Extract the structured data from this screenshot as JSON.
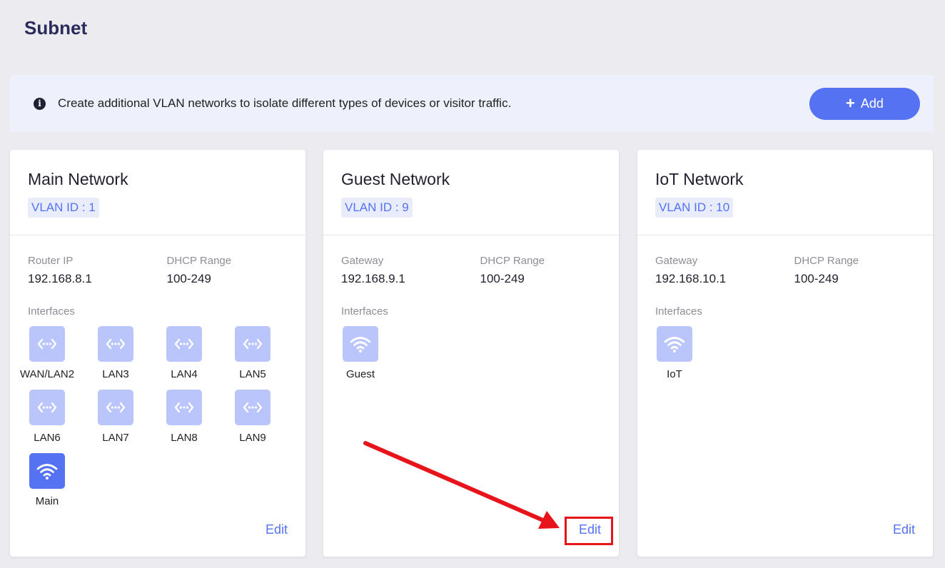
{
  "page": {
    "title": "Subnet"
  },
  "banner": {
    "text": "Create additional VLAN networks to isolate different types of devices or visitor traffic.",
    "add_label": "Add",
    "info_icon": "info-circle-icon"
  },
  "colors": {
    "accent": "#5472f2",
    "tile_inactive": "#b9c5fb",
    "annotation": "#e8141b"
  },
  "cards": [
    {
      "title": "Main Network",
      "vlan": "VLAN ID : 1",
      "fields": [
        {
          "label": "Router IP",
          "value": "192.168.8.1"
        },
        {
          "label": "DHCP Range",
          "value": "100-249"
        }
      ],
      "interfaces_label": "Interfaces",
      "interfaces": [
        {
          "label": "WAN/LAN2",
          "icon": "ethernet-icon",
          "active": false
        },
        {
          "label": "LAN3",
          "icon": "ethernet-icon",
          "active": false
        },
        {
          "label": "LAN4",
          "icon": "ethernet-icon",
          "active": false
        },
        {
          "label": "LAN5",
          "icon": "ethernet-icon",
          "active": false
        },
        {
          "label": "LAN6",
          "icon": "ethernet-icon",
          "active": false
        },
        {
          "label": "LAN7",
          "icon": "ethernet-icon",
          "active": false
        },
        {
          "label": "LAN8",
          "icon": "ethernet-icon",
          "active": false
        },
        {
          "label": "LAN9",
          "icon": "ethernet-icon",
          "active": false
        },
        {
          "label": "Main",
          "icon": "wifi-icon",
          "active": true
        }
      ],
      "edit_label": "Edit"
    },
    {
      "title": "Guest Network",
      "vlan": "VLAN ID : 9",
      "fields": [
        {
          "label": "Gateway",
          "value": "192.168.9.1"
        },
        {
          "label": "DHCP Range",
          "value": "100-249"
        }
      ],
      "interfaces_label": "Interfaces",
      "interfaces": [
        {
          "label": "Guest",
          "icon": "wifi-icon",
          "active": false
        }
      ],
      "edit_label": "Edit"
    },
    {
      "title": "IoT Network",
      "vlan": "VLAN ID : 10",
      "fields": [
        {
          "label": "Gateway",
          "value": "192.168.10.1"
        },
        {
          "label": "DHCP Range",
          "value": "100-249"
        }
      ],
      "interfaces_label": "Interfaces",
      "interfaces": [
        {
          "label": "IoT",
          "icon": "wifi-icon",
          "active": false
        }
      ],
      "edit_label": "Edit"
    }
  ]
}
